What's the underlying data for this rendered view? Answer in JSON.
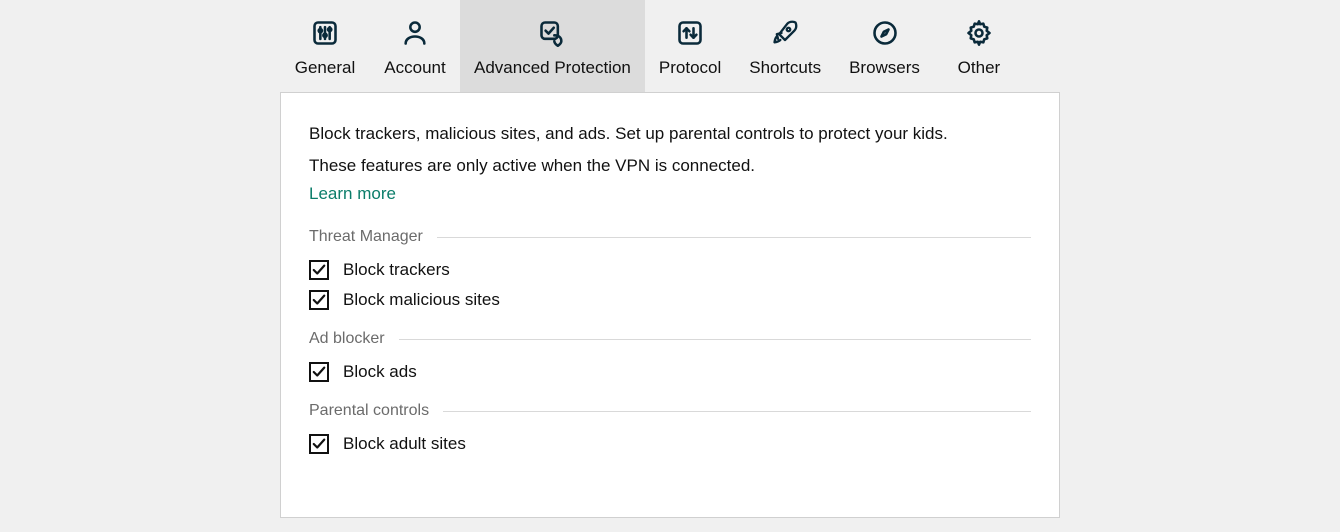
{
  "tabs": [
    {
      "id": "general",
      "label": "General",
      "active": false
    },
    {
      "id": "account",
      "label": "Account",
      "active": false
    },
    {
      "id": "advanced",
      "label": "Advanced Protection",
      "active": true
    },
    {
      "id": "protocol",
      "label": "Protocol",
      "active": false
    },
    {
      "id": "shortcuts",
      "label": "Shortcuts",
      "active": false
    },
    {
      "id": "browsers",
      "label": "Browsers",
      "active": false
    },
    {
      "id": "other",
      "label": "Other",
      "active": false
    }
  ],
  "content": {
    "desc_line1": "Block trackers, malicious sites, and ads. Set up parental controls to protect your kids.",
    "desc_line2": "These features are only active when the VPN is connected.",
    "learn_more": "Learn more",
    "sections": {
      "threat": {
        "title": "Threat Manager",
        "items": [
          {
            "label": "Block trackers",
            "checked": true
          },
          {
            "label": "Block malicious sites",
            "checked": true
          }
        ]
      },
      "ad": {
        "title": "Ad blocker",
        "items": [
          {
            "label": "Block ads",
            "checked": true
          }
        ]
      },
      "parental": {
        "title": "Parental controls",
        "items": [
          {
            "label": "Block adult sites",
            "checked": true
          }
        ]
      }
    }
  }
}
